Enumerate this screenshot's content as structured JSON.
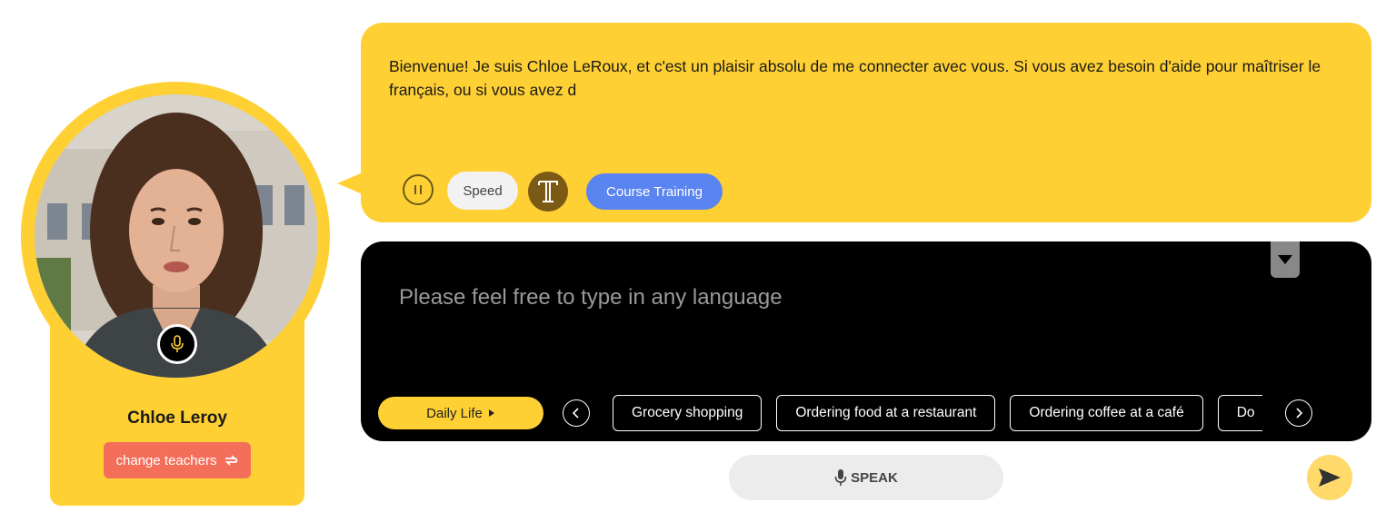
{
  "teacher": {
    "name": "Chloe Leroy",
    "change_label": "change teachers",
    "avatar_alt": "teacher portrait"
  },
  "bubble": {
    "message": "Bienvenue! Je suis Chloe LeRoux, et c'est un plaisir absolu de me connecter avec vous. Si vous avez besoin d'aide pour maîtriser le français, ou si vous avez d",
    "speed_label": "Speed",
    "course_label": "Course Training"
  },
  "input": {
    "placeholder": "Please feel free to type in any language",
    "category_label": "Daily Life",
    "topics": [
      "Grocery shopping",
      "Ordering food at a restaurant",
      "Ordering coffee at a café",
      "Do"
    ]
  },
  "actions": {
    "speak_label": "SPEAK"
  },
  "colors": {
    "accent_yellow": "#ffd033",
    "coral": "#f46f5a",
    "blue": "#5a84f0",
    "panel_black": "#000000"
  },
  "icons": {
    "mic": "microphone-icon",
    "swap": "swap-icon",
    "pause": "pause-icon",
    "text": "text-icon",
    "collapse": "caret-down-icon",
    "prev": "chevron-left-icon",
    "next": "chevron-right-icon",
    "send": "send-icon"
  }
}
